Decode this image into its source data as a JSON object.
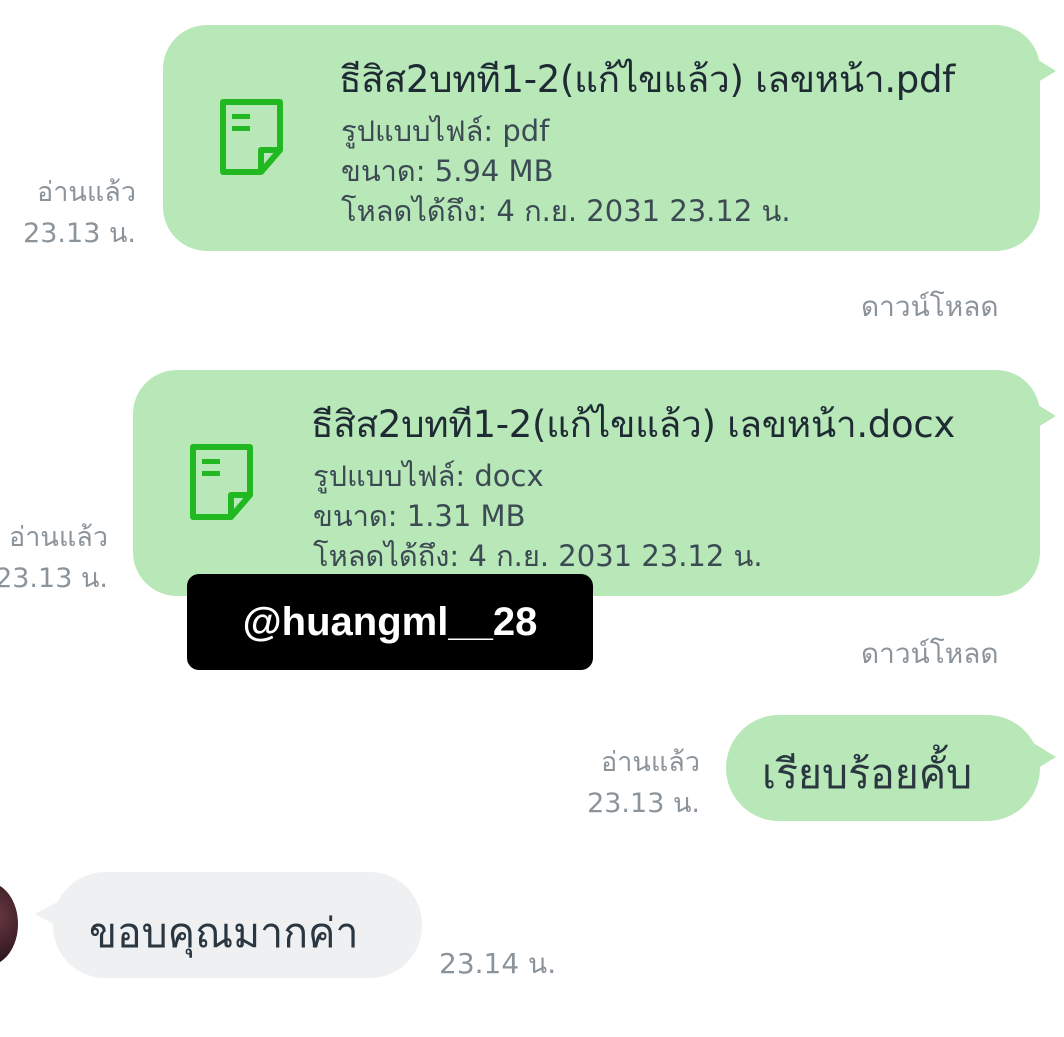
{
  "messages": [
    {
      "type": "file",
      "file_name": "ธีสิส2บทที1-2(แก้ไขแล้ว) เลขหน้า.pdf",
      "format_line": "รูปแบบไฟล์: pdf",
      "size_line": "ขนาด: 5.94 MB",
      "expiry_line": "โหลดได้ถึง: 4 ก.ย. 2031 23.12 น.",
      "read_status": "อ่านแล้ว",
      "time": "23.13 น.",
      "download_label": "ดาวน์โหลด",
      "icon": "document-icon"
    },
    {
      "type": "file",
      "file_name": "ธีสิส2บทที1-2(แก้ไขแล้ว) เลขหน้า.docx",
      "format_line": "รูปแบบไฟล์: docx",
      "size_line": "ขนาด: 1.31 MB",
      "expiry_line": "โหลดได้ถึง: 4 ก.ย. 2031 23.12 น.",
      "read_status": "อ่านแล้ว",
      "time": "23.13 น.",
      "download_label": "ดาวน์โหลด",
      "icon": "document-icon"
    },
    {
      "type": "text",
      "text": "เรียบร้อยคั้บ",
      "read_status": "อ่านแล้ว",
      "time": "23.13 น."
    },
    {
      "type": "incoming",
      "text": "ขอบคุณมากค่า",
      "time": "23.14 น."
    }
  ],
  "watermark": "@huangml__28",
  "colors": {
    "outgoing_bubble": "#b8e8b8",
    "incoming_bubble": "#eef0f2",
    "file_icon": "#22b822",
    "meta_text": "#8c949b"
  }
}
